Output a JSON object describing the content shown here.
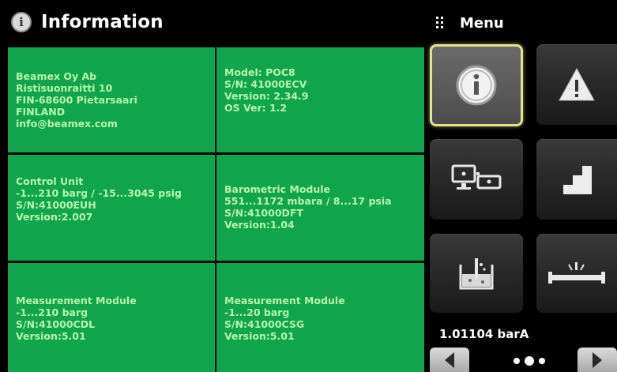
{
  "header": {
    "title": "Information",
    "icon": "info-icon",
    "menu_label": "Menu",
    "menu_icon": "grip-icon"
  },
  "tiles": [
    {
      "lines": [
        "Beamex Oy Ab",
        "Ristisuonraitti 10",
        "FIN-68600 Pietarsaari",
        "FINLAND",
        "info@beamex.com"
      ]
    },
    {
      "lines": [
        "Model: POC8",
        "S/N: 41000ECV",
        "Version: 2.34.9",
        "OS Ver: 1.2"
      ]
    },
    {
      "lines": [
        "Control Unit",
        "-1...210 barg / -15...3045 psig",
        "S/N:41000EUH",
        "Version:2.007"
      ]
    },
    {
      "lines": [
        "Barometric Module",
        "551...1172 mbara / 8...17 psia",
        "S/N:41000DFT",
        "Version:1.04"
      ]
    },
    {
      "lines": [
        "Measurement Module",
        "-1...210 barg",
        "S/N:41000CDL",
        "Version:5.01"
      ]
    },
    {
      "lines": [
        "Measurement Module",
        "-1...20 barg",
        "S/N:41000CSG",
        "Version:5.01"
      ]
    }
  ],
  "menu": {
    "buttons": [
      {
        "icon": "info-icon",
        "selected": true
      },
      {
        "icon": "warning-icon",
        "selected": false
      },
      {
        "icon": "display-settings-icon",
        "selected": false
      },
      {
        "icon": "step-icon",
        "selected": false
      },
      {
        "icon": "leak-test-icon",
        "selected": false
      },
      {
        "icon": "pipe-burst-icon",
        "selected": false
      }
    ],
    "barometer_reading": "1.01104 barA",
    "page_indicator": {
      "pages": 3,
      "current": 2
    }
  },
  "colors": {
    "tile_background": "#10a54c",
    "tile_text": "#b8f5ac",
    "selected_border": "#e3e48a",
    "background": "#000000"
  }
}
